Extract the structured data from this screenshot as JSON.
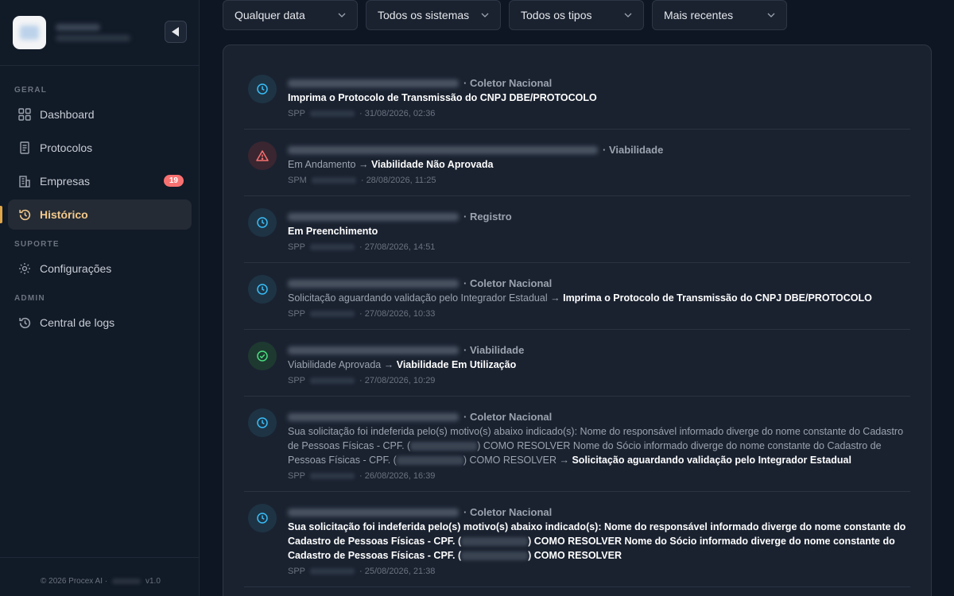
{
  "sidebar": {
    "collapse_icon": "triangle-left-icon",
    "sections": {
      "geral": "GERAL",
      "suporte": "SUPORTE",
      "admin": "ADMIN"
    },
    "items": [
      {
        "label": "Dashboard",
        "icon": "grid-icon"
      },
      {
        "label": "Protocolos",
        "icon": "document-icon"
      },
      {
        "label": "Empresas",
        "icon": "building-icon",
        "badge": "19"
      },
      {
        "label": "Histórico",
        "icon": "history-icon",
        "active": true
      },
      {
        "label": "Configurações",
        "icon": "sun-icon"
      },
      {
        "label": "Central de logs",
        "icon": "history-icon"
      }
    ],
    "footer": {
      "copyright": "© 2026 Procex AI ·",
      "version": "v1.0"
    }
  },
  "filters": [
    {
      "label": "Qualquer data"
    },
    {
      "label": "Todos os sistemas"
    },
    {
      "label": "Todos os tipos"
    },
    {
      "label": "Mais recentes"
    }
  ],
  "entries": [
    {
      "status": "clock",
      "system": "· Coletor Nacional",
      "new_status": "Imprima o Protocolo de Transmissão do CNPJ DBE/PROTOCOLO",
      "org": "SPP",
      "time": "· 31/08/2026, 02:36"
    },
    {
      "status": "warning",
      "system": "· Viabilidade",
      "old_status": "Em Andamento",
      "arrow": "→",
      "new_status": "Viabilidade Não Aprovada",
      "org": "SPM",
      "time": "· 28/08/2026, 11:25"
    },
    {
      "status": "clock",
      "system": "· Registro",
      "new_status": "Em Preenchimento",
      "org": "SPP",
      "time": "· 27/08/2026, 14:51"
    },
    {
      "status": "clock",
      "system": "· Coletor Nacional",
      "old_status": "Solicitação aguardando validação pelo Integrador Estadual",
      "arrow": "→",
      "new_status": "Imprima o Protocolo de Transmissão do CNPJ DBE/PROTOCOLO",
      "org": "SPP",
      "time": "· 27/08/2026, 10:33"
    },
    {
      "status": "check",
      "system": "· Viabilidade",
      "old_status": "Viabilidade Aprovada",
      "arrow": "→",
      "new_status": "Viabilidade Em Utilização",
      "org": "SPP",
      "time": "· 27/08/2026, 10:29"
    },
    {
      "status": "clock",
      "system": "· Coletor Nacional",
      "old_a": "Sua solicitação foi indeferida pelo(s) motivo(s) abaixo indicado(s): Nome do responsável informado diverge do nome constante do Cadastro de Pessoas Físicas - CPF. (",
      "old_b": ") COMO RESOLVER Nome do Sócio informado diverge do nome constante do Cadastro de Pessoas Físicas - CPF. (",
      "old_c": ") COMO RESOLVER",
      "arrow": "→",
      "new_status": "Solicitação aguardando validação pelo Integrador Estadual",
      "org": "SPP",
      "time": "· 26/08/2026, 16:39"
    },
    {
      "status": "clock",
      "system": "· Coletor Nacional",
      "new_a": "Sua solicitação foi indeferida pelo(s) motivo(s) abaixo indicado(s): Nome do responsável informado diverge do nome constante do Cadastro de Pessoas Físicas - CPF. (",
      "new_b": ") COMO RESOLVER Nome do Sócio informado diverge do nome constante do Cadastro de Pessoas Físicas - CPF. (",
      "new_c": ") COMO RESOLVER",
      "org": "SPP",
      "time": "· 25/08/2026, 21:38"
    }
  ]
}
